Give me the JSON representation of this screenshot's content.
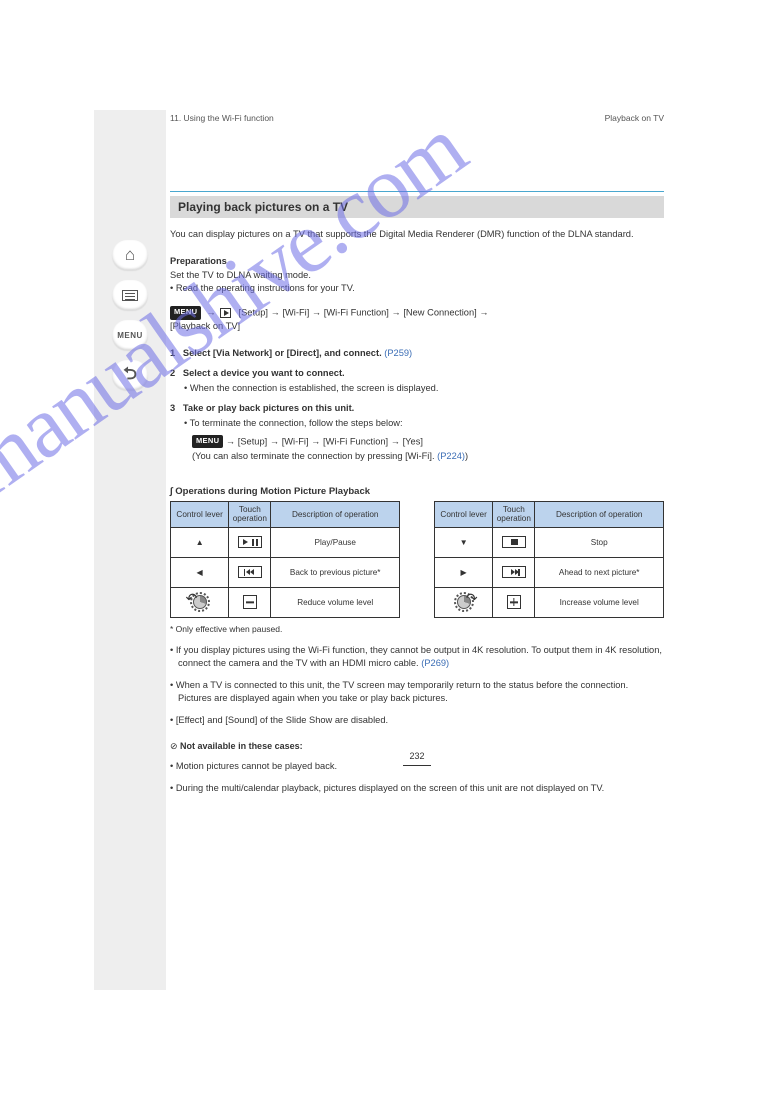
{
  "nav": {
    "menu_label": "MENU"
  },
  "header": {
    "left": "11. Using the Wi-Fi function",
    "right": "Playback on TV"
  },
  "section_title": "Playing back pictures on a TV",
  "intro": "You can display pictures on a TV that supports the Digital Media Renderer (DMR) function of the DLNA standard.",
  "prep_label": "Preparations",
  "prep_text": "Set the TV to DLNA waiting mode.\n• Read the operating instructions for your TV.",
  "menu_path_label": "MENU",
  "menu_path": [
    "[Setup]",
    "[Wi-Fi]",
    "[Wi-Fi Function]",
    "[New Connection]",
    "[Playback on TV]"
  ],
  "step1": {
    "num": "1",
    "text": "Select [Via Network] or [Direct], and connect.",
    "ref": "(P259)"
  },
  "step2": {
    "num": "2",
    "text": "Select a device you want to connect."
  },
  "step2b": "• When the connection is established, the screen is displayed.",
  "step3": {
    "num": "3",
    "text": "Take or play back pictures on this unit."
  },
  "terminate_line": "• To terminate the connection, follow the steps below:",
  "terminate_path_label": "MENU",
  "terminate_path": [
    "[Setup]",
    "[Wi-Fi]",
    "[Wi-Fi Function]",
    "[Yes]"
  ],
  "terminate_note": "(You can also terminate the connection by pressing [Wi-Fi].",
  "terminate_ref": "(P224)",
  "ops_title": "Operations during Motion Picture Playback",
  "table_headers": {
    "c1": "Control lever",
    "c2": "Touch operation",
    "c3": "Description of operation"
  },
  "ops": [
    {
      "lever": "▲",
      "touch": "playpause",
      "desc": "Play/Pause"
    },
    {
      "lever": "▼",
      "touch": "stop",
      "desc": "Stop"
    },
    {
      "lever": "◀",
      "touch": "prev",
      "desc": "Back to previous picture*"
    },
    {
      "lever": "▶",
      "touch": "next",
      "desc": "Ahead to next picture*"
    },
    {
      "lever": "dial-left",
      "touch": "minus",
      "desc": "Reduce volume level"
    },
    {
      "lever": "dial-right",
      "touch": "plus",
      "desc": "Increase volume level"
    }
  ],
  "asterisk": "* Only effective when paused.",
  "notes": [
    "If you display pictures using the Wi-Fi function, they cannot be output in 4K resolution. To output them in 4K resolution, connect the camera and the TV with an HDMI micro cable.",
    "When a TV is connected to this unit, the TV screen may temporarily return to the status before the connection. Pictures are displayed again when you take or play back pictures.",
    "[Effect] and [Sound] of the Slide Show are disabled.",
    "Motion pictures cannot be played back.",
    "During the multi/calendar playback, pictures displayed on the screen of this unit are not displayed on TV."
  ],
  "notes_ref": "(P269)",
  "not_available_heading": "Not available in these cases:",
  "page_number": "232",
  "watermark": "manualshive.com"
}
